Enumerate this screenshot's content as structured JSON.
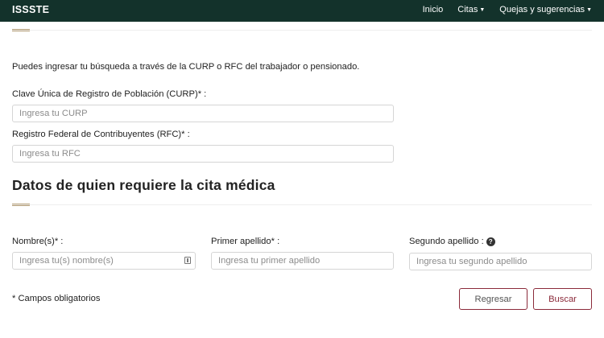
{
  "navbar": {
    "brand": "ISSSTE",
    "items": [
      {
        "label": "Inicio",
        "dropdown": false
      },
      {
        "label": "Citas",
        "dropdown": true
      },
      {
        "label": "Quejas y sugerencias",
        "dropdown": true
      }
    ],
    "background_color": "#13322b"
  },
  "search": {
    "intro": "Puedes ingresar tu búsqueda a través de la CURP o RFC del trabajador o pensionado.",
    "curp_label": "Clave Única de Registro de Población (CURP)* :",
    "curp_placeholder": "Ingresa tu CURP",
    "rfc_label": "Registro Federal de Contribuyentes (RFC)* :",
    "rfc_placeholder": "Ingresa tu RFC"
  },
  "patient": {
    "title": "Datos de quien requiere la cita médica",
    "name_label": "Nombre(s)* :",
    "name_placeholder": "Ingresa tu(s) nombre(s)",
    "first_surname_label": "Primer apellido* :",
    "first_surname_placeholder": "Ingresa tu primer apellido",
    "second_surname_label": "Segundo apellido :",
    "second_surname_placeholder": "Ingresa tu segundo apellido",
    "help_icon": "?"
  },
  "footer": {
    "required_note": "* Campos obligatorios",
    "back_label": "Regresar",
    "search_label": "Buscar"
  },
  "colors": {
    "accent": "#b39b72",
    "primary_button": "#8b2a3a"
  }
}
